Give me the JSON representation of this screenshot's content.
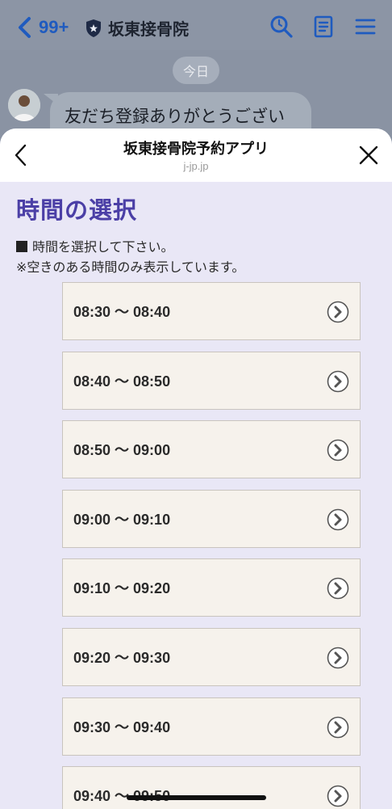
{
  "header": {
    "back_count": "99+",
    "chat_name": "坂東接骨院",
    "icons": [
      "back-icon",
      "shield-icon",
      "search-icon",
      "notes-icon",
      "menu-icon"
    ]
  },
  "chat": {
    "date_label": "今日",
    "message": "友だち登録ありがとうござい"
  },
  "sheet": {
    "title": "坂東接骨院予約アプリ",
    "url": "j-jp.jp",
    "heading": "時間の選択",
    "instruction1": "時間を選択して下さい。",
    "instruction2": "※空きのある時間のみ表示しています。"
  },
  "slots": [
    {
      "label": "08:30 〜 08:40"
    },
    {
      "label": "08:40 〜 08:50"
    },
    {
      "label": "08:50 〜 09:00"
    },
    {
      "label": "09:00 〜 09:10"
    },
    {
      "label": "09:10 〜 09:20"
    },
    {
      "label": "09:20 〜 09:30"
    },
    {
      "label": "09:30 〜 09:40"
    },
    {
      "label": "09:40 〜 09:50"
    }
  ],
  "colors": {
    "accent": "#4b3fa6",
    "link_blue": "#1f5bbf",
    "sheet_bg": "#e9e7f6",
    "slot_bg": "#f6f2ec"
  }
}
